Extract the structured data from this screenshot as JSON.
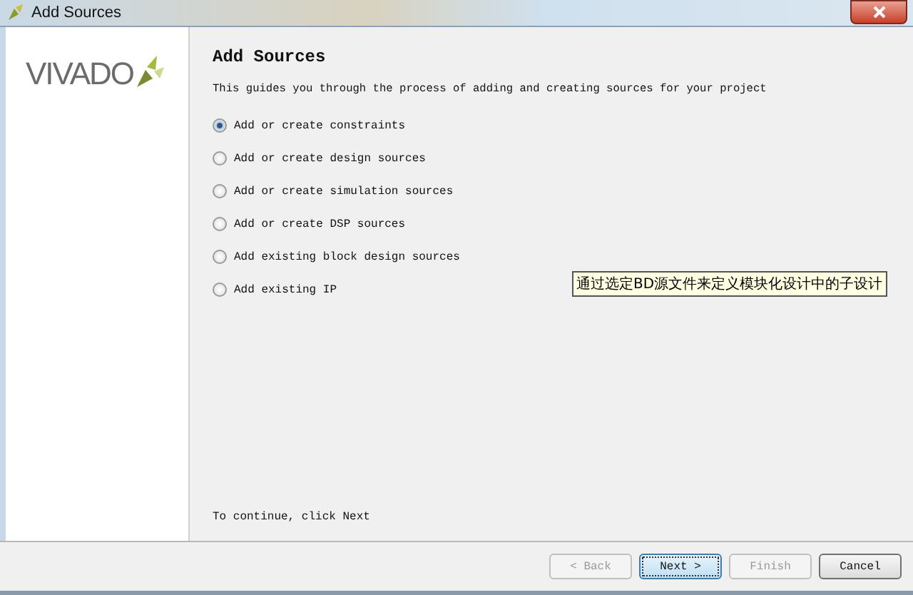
{
  "window": {
    "title": "Add Sources"
  },
  "logo": {
    "text": "VIVADO"
  },
  "page": {
    "heading": "Add Sources",
    "description": "This guides you through the process of adding and creating sources for your project",
    "footer": "To continue, click Next"
  },
  "options": [
    {
      "label": "Add or create constraints",
      "selected": true
    },
    {
      "label": "Add or create design sources",
      "selected": false
    },
    {
      "label": "Add or create simulation sources",
      "selected": false
    },
    {
      "label": "Add or create DSP sources",
      "selected": false
    },
    {
      "label": "Add existing block design sources",
      "selected": false
    },
    {
      "label": "Add existing IP",
      "selected": false
    }
  ],
  "tooltip": "通过选定BD源文件来定义模块化设计中的子设计",
  "buttons": [
    {
      "label": "< Back",
      "disabled": true,
      "focused": false
    },
    {
      "label": "Next >",
      "disabled": false,
      "focused": true
    },
    {
      "label": "Finish",
      "disabled": true,
      "focused": false
    },
    {
      "label": "Cancel",
      "disabled": false,
      "focused": false
    }
  ]
}
